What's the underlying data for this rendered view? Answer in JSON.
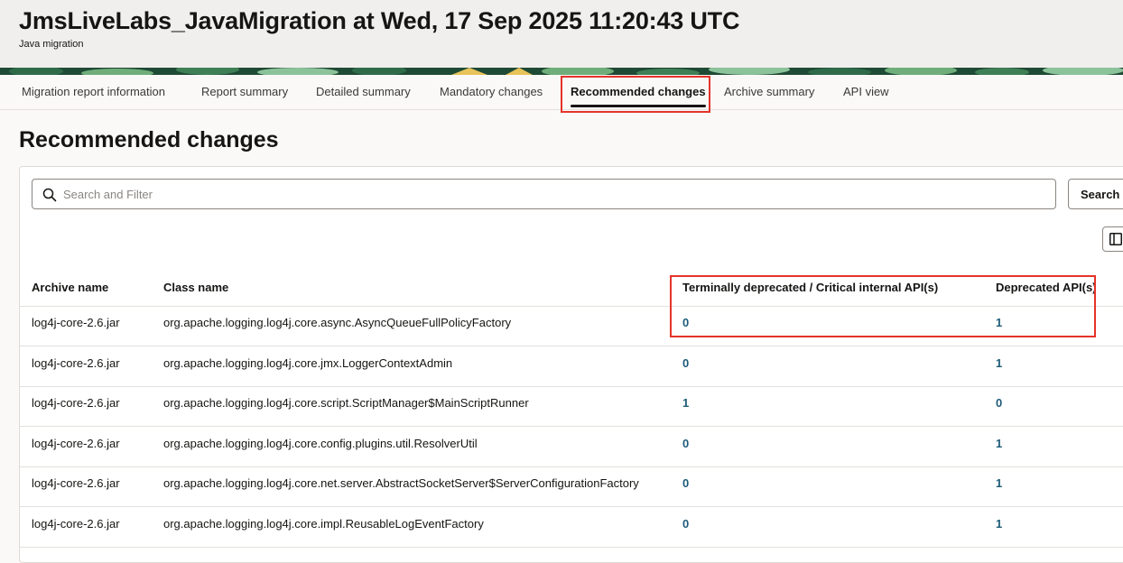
{
  "header": {
    "title": "JmsLiveLabs_JavaMigration at Wed, 17 Sep 2025 11:20:43 UTC",
    "subtitle": "Java migration"
  },
  "tabs": [
    {
      "label": "Migration report information",
      "active": false
    },
    {
      "label": "Report summary",
      "active": false
    },
    {
      "label": "Detailed summary",
      "active": false
    },
    {
      "label": "Mandatory changes",
      "active": false
    },
    {
      "label": "Recommended changes",
      "active": true
    },
    {
      "label": "Archive summary",
      "active": false
    },
    {
      "label": "API view",
      "active": false
    }
  ],
  "page": {
    "heading": "Recommended changes"
  },
  "search": {
    "placeholder": "Search and Filter",
    "button_label": "Search"
  },
  "icons": {
    "search": "search-icon",
    "columns": "columns-icon"
  },
  "table": {
    "headers": {
      "archive": "Archive name",
      "class": "Class name",
      "terminal": "Terminally deprecated / Critical internal API(s)",
      "deprecated": "Deprecated API(s)"
    },
    "rows": [
      {
        "archive": "log4j-core-2.6.jar",
        "class": "org.apache.logging.log4j.core.async.AsyncQueueFullPolicyFactory",
        "terminal": "0",
        "deprecated": "1"
      },
      {
        "archive": "log4j-core-2.6.jar",
        "class": "org.apache.logging.log4j.core.jmx.LoggerContextAdmin",
        "terminal": "0",
        "deprecated": "1"
      },
      {
        "archive": "log4j-core-2.6.jar",
        "class": "org.apache.logging.log4j.core.script.ScriptManager$MainScriptRunner",
        "terminal": "1",
        "deprecated": "0"
      },
      {
        "archive": "log4j-core-2.6.jar",
        "class": "org.apache.logging.log4j.core.config.plugins.util.ResolverUtil",
        "terminal": "0",
        "deprecated": "1"
      },
      {
        "archive": "log4j-core-2.6.jar",
        "class": "org.apache.logging.log4j.core.net.server.AbstractSocketServer$ServerConfigurationFactory",
        "terminal": "0",
        "deprecated": "1"
      },
      {
        "archive": "log4j-core-2.6.jar",
        "class": "org.apache.logging.log4j.core.impl.ReusableLogEventFactory",
        "terminal": "0",
        "deprecated": "1"
      }
    ]
  },
  "colors": {
    "highlight": "#e5332a",
    "link": "#1d5b79",
    "banner_dark": "#1f4a35",
    "banner_leaf": "#6fae7a",
    "banner_yellow": "#e7c35a"
  }
}
